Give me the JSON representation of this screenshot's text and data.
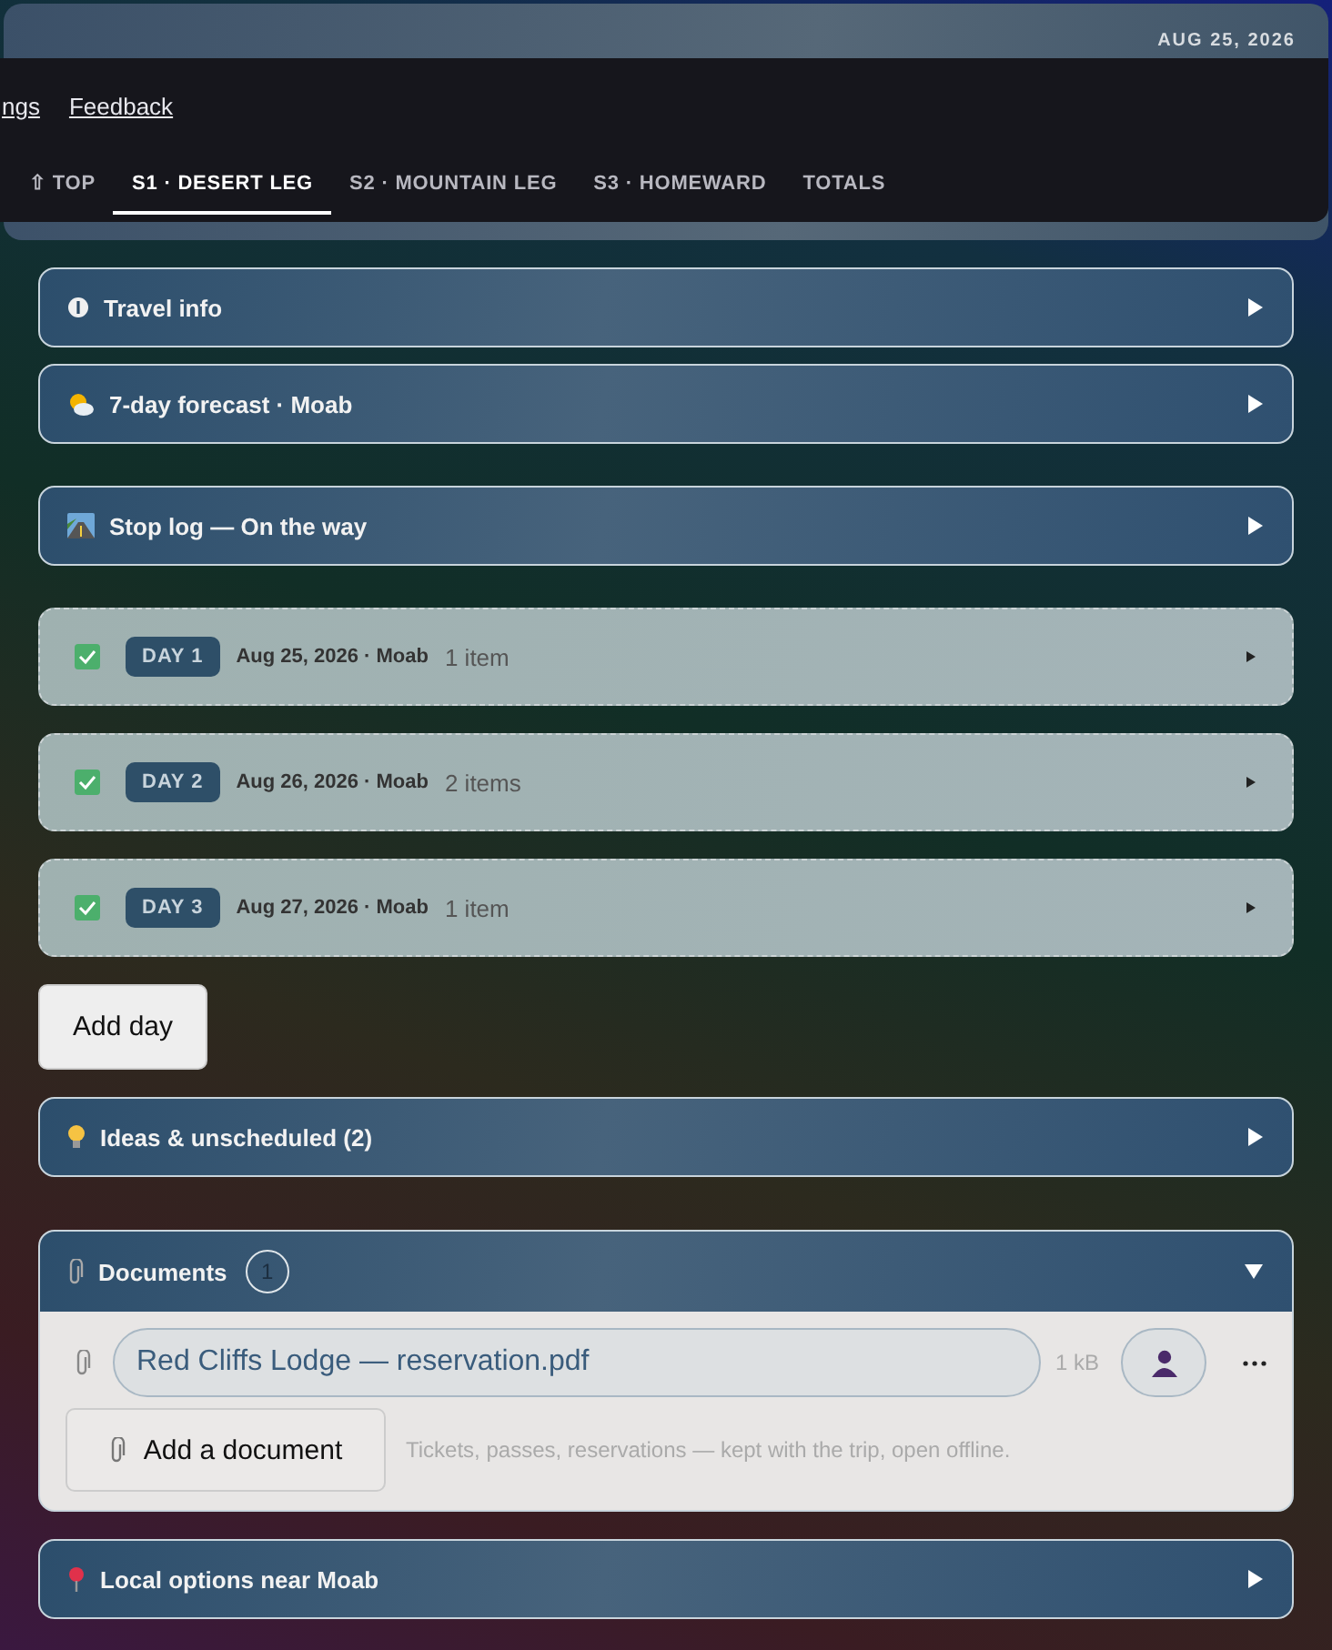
{
  "header": {
    "date": "AUG 25, 2026"
  },
  "links": [
    {
      "label": "ngs"
    },
    {
      "label": "Feedback"
    }
  ],
  "tabs": [
    {
      "label": "⇧ TOP",
      "selected": false
    },
    {
      "label": "S1 · DESERT LEG",
      "selected": true
    },
    {
      "label": "S2 · MOUNTAIN LEG",
      "selected": false
    },
    {
      "label": "S3 · HOMEWARD",
      "selected": false
    },
    {
      "label": "TOTALS",
      "selected": false
    }
  ],
  "panels": [
    {
      "kind": "accordion",
      "title": "Travel info",
      "expanded": false
    },
    {
      "kind": "accordion",
      "title": "7-day forecast · Moab",
      "expanded": false
    },
    {
      "kind": "accordion",
      "title": "Stop log — On the way",
      "expanded": false
    },
    {
      "kind": "day",
      "checked": true,
      "badge": "DAY 1",
      "date": "Aug 25, 2026 · Moab",
      "count": "1 item"
    },
    {
      "kind": "day",
      "checked": true,
      "badge": "DAY 2",
      "date": "Aug 26, 2026 · Moab",
      "count": "2 items"
    },
    {
      "kind": "day",
      "checked": true,
      "badge": "DAY 3",
      "date": "Aug 27, 2026 · Moab",
      "count": "1 item"
    },
    {
      "kind": "button",
      "label": "Add day"
    },
    {
      "kind": "accordion",
      "title": "Ideas & unscheduled (2)",
      "expanded": false
    },
    {
      "kind": "documents",
      "title": "Documents",
      "count": "1",
      "expanded": true,
      "files": [
        {
          "name": "Red Cliffs Lodge — reservation.pdf",
          "size": "1 kB"
        }
      ],
      "add_label": "Add a document",
      "hint": "Tickets, passes, reservations — kept with the trip, open offline."
    },
    {
      "kind": "accordion",
      "title": "Local options near Moab",
      "expanded": false
    }
  ]
}
